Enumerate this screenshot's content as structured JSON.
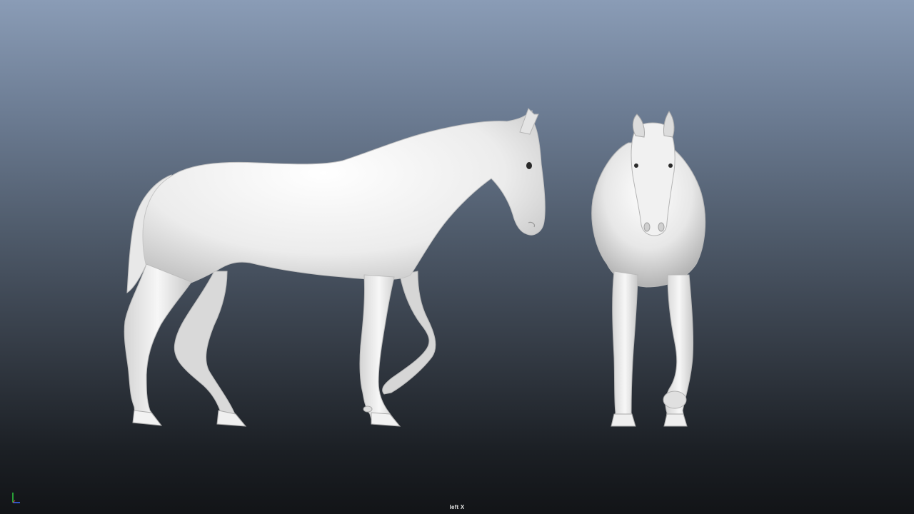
{
  "viewport": {
    "camera_label": "left X",
    "background_top": "#8a9cb6",
    "background_bottom": "#121417"
  },
  "scene": {
    "objects": [
      "horse-side-view",
      "horse-front-view"
    ],
    "model_color": "#e9e9e9"
  },
  "axis_gizmo": {
    "axes": [
      "Y",
      "Z"
    ],
    "colors": {
      "y": "#2ecc40",
      "z": "#3a6cff"
    }
  }
}
